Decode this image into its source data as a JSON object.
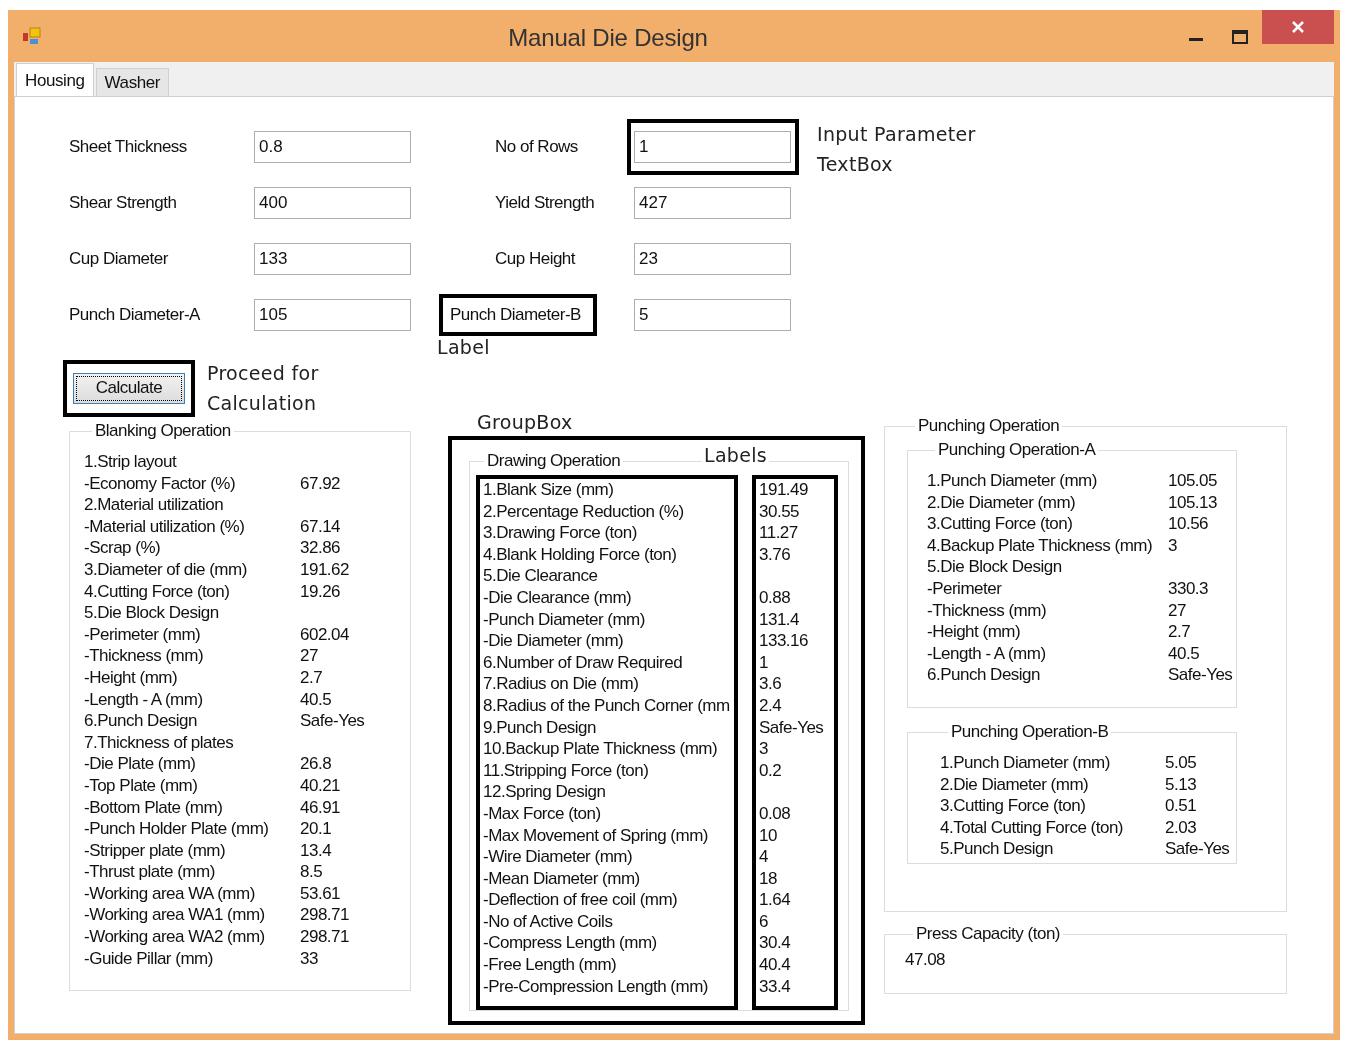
{
  "window": {
    "title": "Manual Die Design"
  },
  "tabs": [
    {
      "label": "Housing",
      "selected": true
    },
    {
      "label": "Washer",
      "selected": false
    }
  ],
  "input_rows": [
    {
      "left": {
        "label": "Sheet Thickness",
        "value": "0.8",
        "label_framed": false,
        "field_framed": false
      },
      "right": {
        "label": "No of Rows",
        "value": "1",
        "label_framed": false,
        "field_framed": true
      }
    },
    {
      "left": {
        "label": "Shear Strength",
        "value": "400",
        "label_framed": false,
        "field_framed": false
      },
      "right": {
        "label": "Yield Strength",
        "value": "427",
        "label_framed": false,
        "field_framed": false
      }
    },
    {
      "left": {
        "label": "Cup Diameter",
        "value": "133",
        "label_framed": false,
        "field_framed": false
      },
      "right": {
        "label": "Cup Height",
        "value": "23",
        "label_framed": false,
        "field_framed": false
      }
    },
    {
      "left": {
        "label": "Punch Diameter-A",
        "value": "105",
        "label_framed": false,
        "field_framed": false
      },
      "right": {
        "label": "Punch Diameter-B",
        "value": "5",
        "label_framed": true,
        "field_framed": false
      }
    }
  ],
  "notes": {
    "textbox": [
      "Input Parameter",
      "TextBox"
    ],
    "label": "Label",
    "calculate": [
      "Proceed for",
      "Calculation"
    ],
    "groupbox": "GroupBox",
    "labels": "Labels"
  },
  "calculate_button": {
    "label": "Calculate",
    "framed": true
  },
  "blanking": {
    "title": "Blanking Operation",
    "rows": [
      {
        "label": "1.Strip layout"
      },
      {
        "label": "-Economy Factor (%)",
        "value": "67.92"
      },
      {
        "label": "2.Material utilization"
      },
      {
        "label": "-Material utilization (%)",
        "value": "67.14"
      },
      {
        "label": "-Scrap (%)",
        "value": "32.86"
      },
      {
        "label": "3.Diameter of die (mm)",
        "value": "191.62"
      },
      {
        "label": "4.Cutting Force (ton)",
        "value": "19.26"
      },
      {
        "label": "5.Die Block Design"
      },
      {
        "label": "-Perimeter (mm)",
        "value": "602.04"
      },
      {
        "label": "-Thickness (mm)",
        "value": "27"
      },
      {
        "label": "-Height (mm)",
        "value": "2.7"
      },
      {
        "label": "-Length - A (mm)",
        "value": "40.5"
      },
      {
        "label": "6.Punch Design",
        "value": "Safe-Yes"
      },
      {
        "label": "7.Thickness of plates"
      },
      {
        "label": "-Die Plate (mm)",
        "value": "26.8"
      },
      {
        "label": "-Top Plate (mm)",
        "value": "40.21"
      },
      {
        "label": "-Bottom Plate (mm)",
        "value": "46.91"
      },
      {
        "label": "-Punch Holder Plate (mm)",
        "value": "20.1"
      },
      {
        "label": "-Stripper plate (mm)",
        "value": "13.4"
      },
      {
        "label": "-Thrust plate (mm)",
        "value": "8.5"
      },
      {
        "label": "-Working area WA (mm)",
        "value": "53.61"
      },
      {
        "label": "-Working area WA1 (mm)",
        "value": "298.71"
      },
      {
        "label": "-Working area WA2 (mm)",
        "value": "298.71"
      },
      {
        "label": "-Guide Pillar (mm)",
        "value": "33"
      }
    ]
  },
  "drawing": {
    "title": "Drawing Operation",
    "framed": true,
    "rows": [
      {
        "label": "1.Blank Size (mm)",
        "value": "191.49"
      },
      {
        "label": "2.Percentage Reduction (%)",
        "value": "30.55"
      },
      {
        "label": "3.Drawing Force (ton)",
        "value": "11.27"
      },
      {
        "label": "4.Blank Holding Force (ton)",
        "value": "3.76"
      },
      {
        "label": "5.Die Clearance"
      },
      {
        "label": "-Die Clearance (mm)",
        "value": "0.88"
      },
      {
        "label": "-Punch Diameter (mm)",
        "value": "131.4"
      },
      {
        "label": "-Die Diameter (mm)",
        "value": "133.16"
      },
      {
        "label": "6.Number of Draw Required",
        "value": "1"
      },
      {
        "label": "7.Radius on Die (mm)",
        "value": "3.6"
      },
      {
        "label": "8.Radius of the Punch Corner (mm",
        "value": "2.4"
      },
      {
        "label": "9.Punch Design",
        "value": "Safe-Yes"
      },
      {
        "label": "10.Backup Plate Thickness (mm)",
        "value": "3"
      },
      {
        "label": "11.Stripping Force (ton)",
        "value": "0.2"
      },
      {
        "label": "12.Spring Design"
      },
      {
        "label": "-Max Force (ton)",
        "value": "0.08"
      },
      {
        "label": "-Max Movement of Spring (mm)",
        "value": "10"
      },
      {
        "label": "-Wire Diameter (mm)",
        "value": "4"
      },
      {
        "label": "-Mean Diameter (mm)",
        "value": "18"
      },
      {
        "label": "-Deflection of free coil (mm)",
        "value": "1.64"
      },
      {
        "label": "-No of Active Coils",
        "value": "6"
      },
      {
        "label": "-Compress Length (mm)",
        "value": "30.4"
      },
      {
        "label": "-Free Length (mm)",
        "value": "40.4"
      },
      {
        "label": "-Pre-Compression Length (mm)",
        "value": "33.4"
      }
    ]
  },
  "punching": {
    "title": "Punching Operation",
    "groups": [
      {
        "title": "Punching Operation-A",
        "rows": [
          {
            "label": "1.Punch Diameter (mm)",
            "value": "105.05"
          },
          {
            "label": "2.Die Diameter (mm)",
            "value": "105.13"
          },
          {
            "label": "3.Cutting Force (ton)",
            "value": "10.56"
          },
          {
            "label": "4.Backup Plate Thickness (mm)",
            "value": "3"
          },
          {
            "label": "5.Die Block Design"
          },
          {
            "label": "-Perimeter",
            "value": "330.3"
          },
          {
            "label": "-Thickness (mm)",
            "value": "27"
          },
          {
            "label": "-Height (mm)",
            "value": "2.7"
          },
          {
            "label": "-Length - A (mm)",
            "value": "40.5"
          },
          {
            "label": "6.Punch Design",
            "value": "Safe-Yes"
          }
        ]
      },
      {
        "title": "Punching Operation-B",
        "rows": [
          {
            "label": "1.Punch Diameter (mm)",
            "value": "5.05"
          },
          {
            "label": "2.Die Diameter (mm)",
            "value": "5.13"
          },
          {
            "label": "3.Cutting Force (ton)",
            "value": "0.51"
          },
          {
            "label": "4.Total Cutting Force (ton)",
            "value": "2.03"
          },
          {
            "label": "5.Punch Design",
            "value": "Safe-Yes"
          }
        ]
      }
    ]
  },
  "press_capacity": {
    "title": "Press Capacity (ton)",
    "value": "47.08"
  }
}
